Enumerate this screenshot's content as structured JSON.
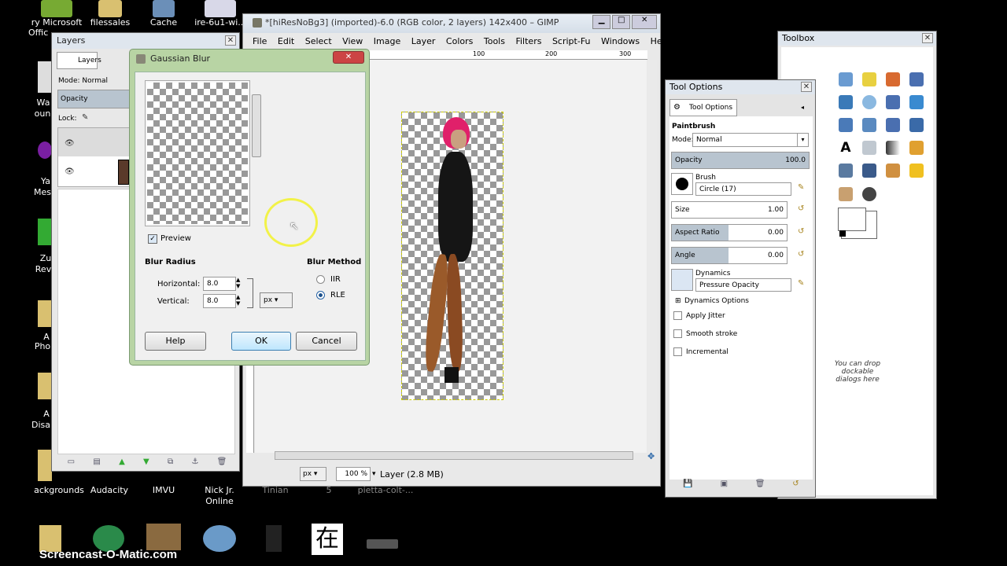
{
  "desktop": {
    "top_icons": [
      {
        "label": "ry Microsoft",
        "label2": "Offic"
      },
      {
        "label": "filessales"
      },
      {
        "label": "Cache"
      },
      {
        "label": "ire-6u1-wi..."
      }
    ],
    "left_labels": [
      "Wa",
      "oun",
      "Ya",
      "Mes",
      "Zu",
      "Rev",
      "A",
      "Pho",
      "A",
      "Disab"
    ],
    "bottom_row1": [
      "ackgrounds",
      "Audacity",
      "IMVU",
      "Nick Jr.",
      "Online",
      "Tinian",
      "5",
      "pietta-colt-..."
    ],
    "bottom_row2_chars": [
      "在"
    ],
    "watermark": "Screencast-O-Matic.com"
  },
  "gimp": {
    "title": "*[hiResNoBg3] (imported)-6.0 (RGB color, 2 layers) 142x400 – GIMP",
    "menu": [
      "File",
      "Edit",
      "Select",
      "View",
      "Image",
      "Layer",
      "Colors",
      "Tools",
      "Filters",
      "Script-Fu",
      "Windows",
      "Help"
    ],
    "ruler_marks": [
      "100",
      "200",
      "300"
    ],
    "status": {
      "unit": "px",
      "zoom": "100 %",
      "layer_info": "Layer (2.8 MB)"
    }
  },
  "layers": {
    "title": "Layers",
    "tab": "Layers",
    "mode_label": "Mode: Normal",
    "opacity_label": "Opacity",
    "lock_label": "Lock:"
  },
  "gaussian": {
    "title": "Gaussian Blur",
    "preview_label": "Preview",
    "blur_radius_label": "Blur Radius",
    "horizontal_label": "Horizontal:",
    "horizontal_value": "8.0",
    "vertical_label": "Vertical:",
    "vertical_value": "8.0",
    "unit": "px",
    "blur_method_label": "Blur Method",
    "method_iir": "IIR",
    "method_rle": "RLE",
    "help": "Help",
    "ok": "OK",
    "cancel": "Cancel"
  },
  "tooloptions": {
    "title": "Tool Options",
    "tab": "Tool Options",
    "tool_name": "Paintbrush",
    "mode_label": "Mode:",
    "mode_value": "Normal",
    "opacity_label": "Opacity",
    "opacity_value": "100.0",
    "brush_label": "Brush",
    "brush_value": "Circle (17)",
    "size_label": "Size",
    "size_value": "1.00",
    "aspect_label": "Aspect Ratio",
    "aspect_value": "0.00",
    "angle_label": "Angle",
    "angle_value": "0.00",
    "dynamics_label": "Dynamics",
    "dynamics_value": "Pressure Opacity",
    "dynamics_options": "Dynamics Options",
    "apply_jitter": "Apply Jitter",
    "smooth_stroke": "Smooth stroke",
    "incremental": "Incremental",
    "drop_hint_1": "You can drop dockable",
    "drop_hint_2": "dialogs here"
  },
  "toolbox": {
    "title": "Toolbox"
  },
  "colors": {
    "titlebar": "#dfe6ee",
    "accent": "#3399ff",
    "slider_fill": "#b8c4cf",
    "cursor_ring": "#f2f200"
  }
}
